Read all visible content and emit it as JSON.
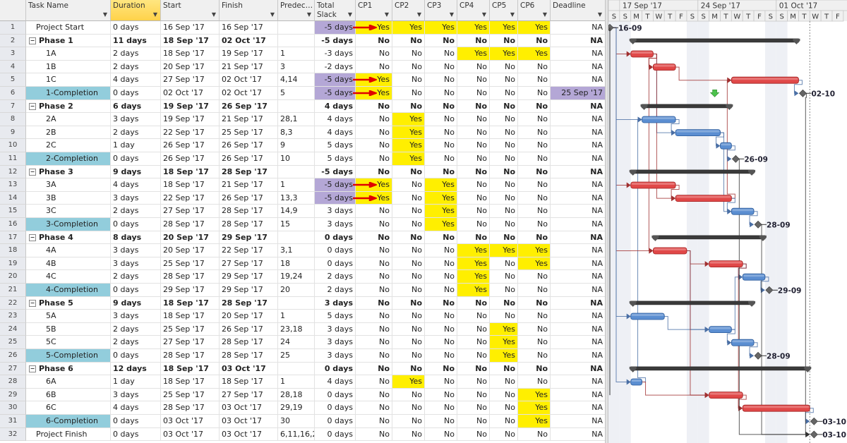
{
  "columns": [
    {
      "key": "name",
      "label": "Task Name"
    },
    {
      "key": "duration",
      "label": "Duration"
    },
    {
      "key": "start",
      "label": "Start"
    },
    {
      "key": "finish",
      "label": "Finish"
    },
    {
      "key": "pred",
      "label": "Predec…"
    },
    {
      "key": "slack",
      "label": "Total Slack"
    },
    {
      "key": "cp1",
      "label": "CP1"
    },
    {
      "key": "cp2",
      "label": "CP2"
    },
    {
      "key": "cp3",
      "label": "CP3"
    },
    {
      "key": "cp4",
      "label": "CP4"
    },
    {
      "key": "cp5",
      "label": "CP5"
    },
    {
      "key": "cp6",
      "label": "CP6"
    },
    {
      "key": "deadline",
      "label": "Deadline"
    }
  ],
  "selected_column": "duration",
  "colors": {
    "critical_bar": "#e04848",
    "normal_bar": "#5b8ed1",
    "summary_bar": "#3a3a3a",
    "highlight_yes": "#ffef00",
    "highlight_slack": "#b4a7d6",
    "completion_cell": "#92cddc",
    "annotation_arrow": "#e00000"
  },
  "rows": [
    {
      "id": 1,
      "name": "Project Start",
      "level": 1,
      "type": "milestone",
      "duration": "0 days",
      "start": "16 Sep '17",
      "finish": "16 Sep '17",
      "pred": "",
      "slack": "-5 days",
      "cp": [
        "Yes",
        "Yes",
        "Yes",
        "Yes",
        "Yes",
        "Yes"
      ],
      "deadline": "NA",
      "slack_hl": true,
      "arrow": true,
      "label": "16-09",
      "s": 0,
      "d": 0
    },
    {
      "id": 2,
      "name": "Phase 1",
      "level": 0,
      "type": "summary",
      "duration": "11 days",
      "start": "18 Sep '17",
      "finish": "02 Oct '17",
      "pred": "",
      "slack": "-5 days",
      "cp": [
        "No",
        "No",
        "No",
        "No",
        "No",
        "No"
      ],
      "deadline": "NA",
      "s": 2,
      "d": 15
    },
    {
      "id": 3,
      "name": "1A",
      "level": 2,
      "type": "task",
      "crit": true,
      "duration": "2 days",
      "start": "18 Sep '17",
      "finish": "19 Sep '17",
      "pred": "1",
      "slack": "-3 days",
      "cp": [
        "No",
        "No",
        "No",
        "Yes",
        "Yes",
        "Yes"
      ],
      "deadline": "NA",
      "s": 2,
      "d": 2
    },
    {
      "id": 4,
      "name": "1B",
      "level": 2,
      "type": "task",
      "crit": true,
      "duration": "2 days",
      "start": "20 Sep '17",
      "finish": "21 Sep '17",
      "pred": "3",
      "slack": "-2 days",
      "cp": [
        "No",
        "No",
        "No",
        "No",
        "No",
        "No"
      ],
      "deadline": "NA",
      "s": 4,
      "d": 2
    },
    {
      "id": 5,
      "name": "1C",
      "level": 2,
      "type": "task",
      "crit": true,
      "duration": "4 days",
      "start": "27 Sep '17",
      "finish": "02 Oct '17",
      "pred": "4,14",
      "slack": "-5 days",
      "cp": [
        "Yes",
        "No",
        "No",
        "No",
        "No",
        "No"
      ],
      "deadline": "NA",
      "slack_hl": true,
      "arrow": true,
      "s": 11,
      "d": 6
    },
    {
      "id": 6,
      "name": "1-Completion",
      "level": 2,
      "type": "milestone",
      "completion": true,
      "duration": "0 days",
      "start": "02 Oct '17",
      "finish": "02 Oct '17",
      "pred": "5",
      "slack": "-5 days",
      "cp": [
        "Yes",
        "No",
        "No",
        "No",
        "No",
        "No"
      ],
      "deadline": "25 Sep '17",
      "deadline_hl": true,
      "slack_hl": true,
      "arrow": true,
      "label": "02-10",
      "s": 17,
      "d": 0
    },
    {
      "id": 7,
      "name": "Phase 2",
      "level": 0,
      "type": "summary",
      "duration": "6 days",
      "start": "19 Sep '17",
      "finish": "26 Sep '17",
      "pred": "",
      "slack": "4 days",
      "cp": [
        "No",
        "No",
        "No",
        "No",
        "No",
        "No"
      ],
      "deadline": "NA",
      "s": 3,
      "d": 8
    },
    {
      "id": 8,
      "name": "2A",
      "level": 2,
      "type": "task",
      "duration": "3 days",
      "start": "19 Sep '17",
      "finish": "21 Sep '17",
      "pred": "28,1",
      "slack": "4 days",
      "cp": [
        "No",
        "Yes",
        "No",
        "No",
        "No",
        "No"
      ],
      "deadline": "NA",
      "s": 3,
      "d": 3
    },
    {
      "id": 9,
      "name": "2B",
      "level": 2,
      "type": "task",
      "duration": "2 days",
      "start": "22 Sep '17",
      "finish": "25 Sep '17",
      "pred": "8,3",
      "slack": "4 days",
      "cp": [
        "No",
        "Yes",
        "No",
        "No",
        "No",
        "No"
      ],
      "deadline": "NA",
      "s": 6,
      "d": 4
    },
    {
      "id": 10,
      "name": "2C",
      "level": 2,
      "type": "task",
      "duration": "1 day",
      "start": "26 Sep '17",
      "finish": "26 Sep '17",
      "pred": "9",
      "slack": "5 days",
      "cp": [
        "No",
        "Yes",
        "No",
        "No",
        "No",
        "No"
      ],
      "deadline": "NA",
      "s": 10,
      "d": 1
    },
    {
      "id": 11,
      "name": "2-Completion",
      "level": 2,
      "type": "milestone",
      "completion": true,
      "duration": "0 days",
      "start": "26 Sep '17",
      "finish": "26 Sep '17",
      "pred": "10",
      "slack": "5 days",
      "cp": [
        "No",
        "Yes",
        "No",
        "No",
        "No",
        "No"
      ],
      "deadline": "NA",
      "label": "26-09",
      "s": 11,
      "d": 0
    },
    {
      "id": 12,
      "name": "Phase 3",
      "level": 0,
      "type": "summary",
      "duration": "9 days",
      "start": "18 Sep '17",
      "finish": "28 Sep '17",
      "pred": "",
      "slack": "-5 days",
      "cp": [
        "No",
        "No",
        "No",
        "No",
        "No",
        "No"
      ],
      "deadline": "NA",
      "s": 2,
      "d": 11
    },
    {
      "id": 13,
      "name": "3A",
      "level": 2,
      "type": "task",
      "crit": true,
      "duration": "4 days",
      "start": "18 Sep '17",
      "finish": "21 Sep '17",
      "pred": "1",
      "slack": "-5 days",
      "cp": [
        "Yes",
        "No",
        "Yes",
        "No",
        "No",
        "No"
      ],
      "deadline": "NA",
      "slack_hl": true,
      "arrow": true,
      "s": 2,
      "d": 4
    },
    {
      "id": 14,
      "name": "3B",
      "level": 2,
      "type": "task",
      "crit": true,
      "duration": "3 days",
      "start": "22 Sep '17",
      "finish": "26 Sep '17",
      "pred": "13,3",
      "slack": "-5 days",
      "cp": [
        "Yes",
        "No",
        "Yes",
        "No",
        "No",
        "No"
      ],
      "deadline": "NA",
      "slack_hl": true,
      "arrow": true,
      "s": 6,
      "d": 5
    },
    {
      "id": 15,
      "name": "3C",
      "level": 2,
      "type": "task",
      "duration": "2 days",
      "start": "27 Sep '17",
      "finish": "28 Sep '17",
      "pred": "14,9",
      "slack": "3 days",
      "cp": [
        "No",
        "No",
        "Yes",
        "No",
        "No",
        "No"
      ],
      "deadline": "NA",
      "s": 11,
      "d": 2
    },
    {
      "id": 16,
      "name": "3-Completion",
      "level": 2,
      "type": "milestone",
      "completion": true,
      "duration": "0 days",
      "start": "28 Sep '17",
      "finish": "28 Sep '17",
      "pred": "15",
      "slack": "3 days",
      "cp": [
        "No",
        "No",
        "Yes",
        "No",
        "No",
        "No"
      ],
      "deadline": "NA",
      "label": "28-09",
      "s": 13,
      "d": 0
    },
    {
      "id": 17,
      "name": "Phase 4",
      "level": 0,
      "type": "summary",
      "duration": "8 days",
      "start": "20 Sep '17",
      "finish": "29 Sep '17",
      "pred": "",
      "slack": "0 days",
      "cp": [
        "No",
        "No",
        "No",
        "No",
        "No",
        "No"
      ],
      "deadline": "NA",
      "s": 4,
      "d": 10
    },
    {
      "id": 18,
      "name": "4A",
      "level": 2,
      "type": "task",
      "crit": true,
      "duration": "3 days",
      "start": "20 Sep '17",
      "finish": "22 Sep '17",
      "pred": "3,1",
      "slack": "0 days",
      "cp": [
        "No",
        "No",
        "No",
        "Yes",
        "Yes",
        "Yes"
      ],
      "deadline": "NA",
      "s": 4,
      "d": 3
    },
    {
      "id": 19,
      "name": "4B",
      "level": 2,
      "type": "task",
      "crit": true,
      "duration": "3 days",
      "start": "25 Sep '17",
      "finish": "27 Sep '17",
      "pred": "18",
      "slack": "0 days",
      "cp": [
        "No",
        "No",
        "No",
        "Yes",
        "No",
        "Yes"
      ],
      "deadline": "NA",
      "s": 9,
      "d": 3
    },
    {
      "id": 20,
      "name": "4C",
      "level": 2,
      "type": "task",
      "duration": "2 days",
      "start": "28 Sep '17",
      "finish": "29 Sep '17",
      "pred": "19,24",
      "slack": "2 days",
      "cp": [
        "No",
        "No",
        "No",
        "Yes",
        "No",
        "No"
      ],
      "deadline": "NA",
      "s": 12,
      "d": 2
    },
    {
      "id": 21,
      "name": "4-Completion",
      "level": 2,
      "type": "milestone",
      "completion": true,
      "duration": "0 days",
      "start": "29 Sep '17",
      "finish": "29 Sep '17",
      "pred": "20",
      "slack": "2 days",
      "cp": [
        "No",
        "No",
        "No",
        "Yes",
        "No",
        "No"
      ],
      "deadline": "NA",
      "label": "29-09",
      "s": 14,
      "d": 0
    },
    {
      "id": 22,
      "name": "Phase 5",
      "level": 0,
      "type": "summary",
      "duration": "9 days",
      "start": "18 Sep '17",
      "finish": "28 Sep '17",
      "pred": "",
      "slack": "3 days",
      "cp": [
        "No",
        "No",
        "No",
        "No",
        "No",
        "No"
      ],
      "deadline": "NA",
      "s": 2,
      "d": 11
    },
    {
      "id": 23,
      "name": "5A",
      "level": 2,
      "type": "task",
      "duration": "3 days",
      "start": "18 Sep '17",
      "finish": "20 Sep '17",
      "pred": "1",
      "slack": "5 days",
      "cp": [
        "No",
        "No",
        "No",
        "No",
        "No",
        "No"
      ],
      "deadline": "NA",
      "s": 2,
      "d": 3
    },
    {
      "id": 24,
      "name": "5B",
      "level": 2,
      "type": "task",
      "duration": "2 days",
      "start": "25 Sep '17",
      "finish": "26 Sep '17",
      "pred": "23,18",
      "slack": "3 days",
      "cp": [
        "No",
        "No",
        "No",
        "No",
        "Yes",
        "No"
      ],
      "deadline": "NA",
      "s": 9,
      "d": 2
    },
    {
      "id": 25,
      "name": "5C",
      "level": 2,
      "type": "task",
      "duration": "2 days",
      "start": "27 Sep '17",
      "finish": "28 Sep '17",
      "pred": "24",
      "slack": "3 days",
      "cp": [
        "No",
        "No",
        "No",
        "No",
        "Yes",
        "No"
      ],
      "deadline": "NA",
      "s": 11,
      "d": 2
    },
    {
      "id": 26,
      "name": "5-Completion",
      "level": 2,
      "type": "milestone",
      "completion": true,
      "duration": "0 days",
      "start": "28 Sep '17",
      "finish": "28 Sep '17",
      "pred": "25",
      "slack": "3 days",
      "cp": [
        "No",
        "No",
        "No",
        "No",
        "Yes",
        "No"
      ],
      "deadline": "NA",
      "label": "28-09",
      "s": 13,
      "d": 0
    },
    {
      "id": 27,
      "name": "Phase 6",
      "level": 0,
      "type": "summary",
      "duration": "12 days",
      "start": "18 Sep '17",
      "finish": "03 Oct '17",
      "pred": "",
      "slack": "0 days",
      "cp": [
        "No",
        "No",
        "No",
        "No",
        "No",
        "No"
      ],
      "deadline": "NA",
      "s": 2,
      "d": 16
    },
    {
      "id": 28,
      "name": "6A",
      "level": 2,
      "type": "task",
      "duration": "1 day",
      "start": "18 Sep '17",
      "finish": "18 Sep '17",
      "pred": "1",
      "slack": "4 days",
      "cp": [
        "No",
        "Yes",
        "No",
        "No",
        "No",
        "No"
      ],
      "deadline": "NA",
      "s": 2,
      "d": 1
    },
    {
      "id": 29,
      "name": "6B",
      "level": 2,
      "type": "task",
      "crit": true,
      "duration": "3 days",
      "start": "25 Sep '17",
      "finish": "27 Sep '17",
      "pred": "28,18",
      "slack": "0 days",
      "cp": [
        "No",
        "No",
        "No",
        "No",
        "No",
        "Yes"
      ],
      "deadline": "NA",
      "s": 9,
      "d": 3
    },
    {
      "id": 30,
      "name": "6C",
      "level": 2,
      "type": "task",
      "crit": true,
      "duration": "4 days",
      "start": "28 Sep '17",
      "finish": "03 Oct '17",
      "pred": "29,19",
      "slack": "0 days",
      "cp": [
        "No",
        "No",
        "No",
        "No",
        "No",
        "Yes"
      ],
      "deadline": "NA",
      "s": 12,
      "d": 6
    },
    {
      "id": 31,
      "name": "6-Completion",
      "level": 2,
      "type": "milestone",
      "completion": true,
      "duration": "0 days",
      "start": "03 Oct '17",
      "finish": "03 Oct '17",
      "pred": "30",
      "slack": "0 days",
      "cp": [
        "No",
        "No",
        "No",
        "No",
        "No",
        "Yes"
      ],
      "deadline": "NA",
      "label": "03-10",
      "s": 18,
      "d": 0
    },
    {
      "id": 32,
      "name": "Project Finish",
      "level": 1,
      "type": "milestone",
      "duration": "0 days",
      "start": "03 Oct '17",
      "finish": "03 Oct '17",
      "pred": "6,11,16,2",
      "slack": "0 days",
      "cp": [
        "No",
        "No",
        "No",
        "No",
        "No",
        "No"
      ],
      "deadline": "NA",
      "label": "03-10",
      "s": 18,
      "d": 0
    }
  ],
  "timeline": {
    "weeks": [
      "17 Sep '17",
      "24 Sep '17",
      "01 Oct '17"
    ],
    "days": [
      "S",
      "S",
      "M",
      "T",
      "W",
      "T",
      "F",
      "S",
      "S",
      "M",
      "T",
      "W",
      "T",
      "F",
      "S",
      "S",
      "M",
      "T",
      "W",
      "T",
      "F"
    ]
  },
  "deadline_marker_task": 6
}
